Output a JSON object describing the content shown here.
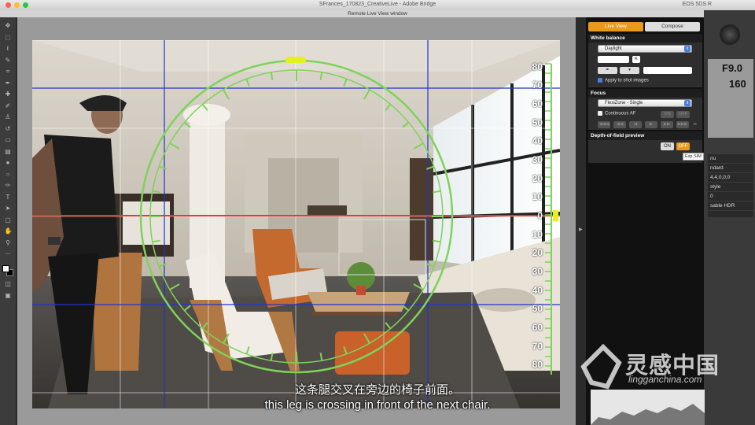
{
  "titlebar": {
    "title": "SFrances_170823_CreativeLive - Adobe Bridge",
    "right_text": "EOS 5DS R"
  },
  "window": {
    "title": "Remote Live View window"
  },
  "viewport": {
    "scale_labels": [
      "80",
      "70",
      "60",
      "50",
      "40",
      "30",
      "20",
      "10",
      "0",
      "10",
      "20",
      "30",
      "40",
      "50",
      "60",
      "70",
      "80"
    ]
  },
  "panel": {
    "tabs": [
      "Live View",
      "Compose"
    ],
    "white_balance": {
      "heading": "White balance",
      "select_value": "Daylight",
      "apply_label": "Apply to shot images"
    },
    "focus": {
      "heading": "Focus",
      "select_value": "FlexiZone - Single",
      "continuous_label": "Continuous AF",
      "on_label": "ON",
      "off_label": "OFF"
    },
    "dof": {
      "heading": "Depth-of-field preview",
      "on_label": "ON",
      "off_label": "OFF",
      "tooltip": "Exp.SIM"
    }
  },
  "camera": {
    "aperture": "F9.0",
    "shutter": "160",
    "menu_items": [
      "nu",
      "ndard",
      "4,4,0,0,0",
      "style",
      "0",
      "sable HDR"
    ]
  },
  "subtitles": {
    "chinese": "这条腿交叉在旁边的椅子前面。",
    "english": "this leg is crossing in front of the next chair."
  },
  "watermark": {
    "name": "灵感中国",
    "url": "lingganchina.com"
  },
  "colors": {
    "accent": "#e99a1a",
    "level_green": "#7ed35a",
    "grid_blue": "#2233cc",
    "horizon_red": "#e04020"
  }
}
